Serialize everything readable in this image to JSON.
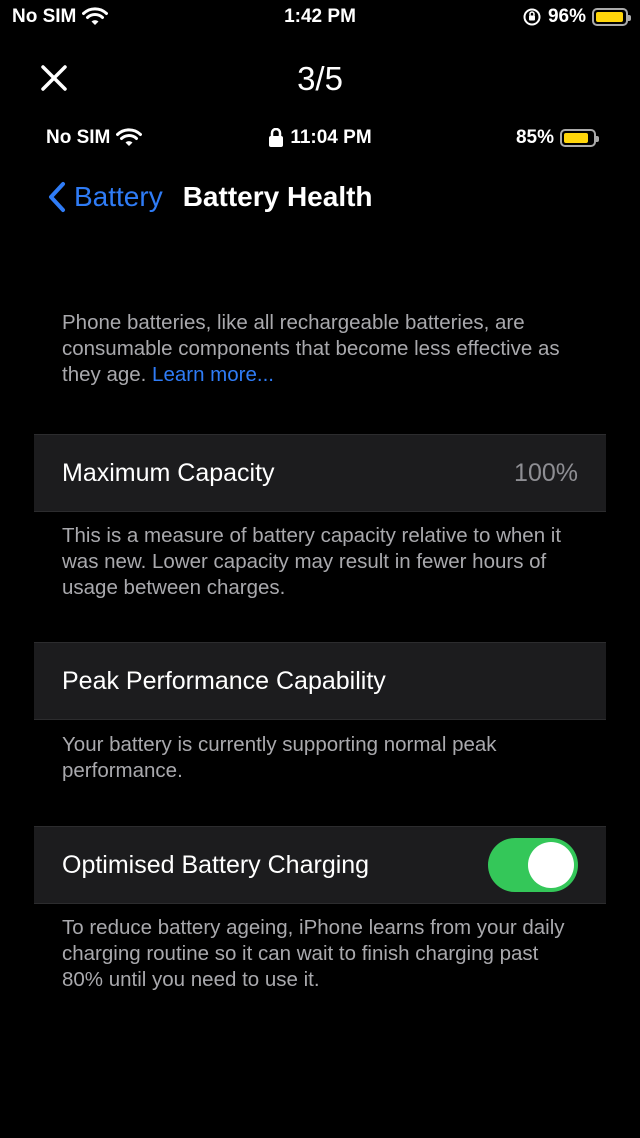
{
  "outer_status": {
    "carrier": "No SIM",
    "time": "1:42 PM",
    "battery": "96%",
    "battery_level": 0.96,
    "battery_color": "#ffd60a"
  },
  "viewer": {
    "counter": "3/5",
    "close_icon": "close-icon"
  },
  "inner_status": {
    "carrier": "No SIM",
    "time": "11:04 PM",
    "battery": "85%",
    "battery_level": 0.85
  },
  "nav": {
    "back_label": "Battery",
    "title": "Battery Health"
  },
  "intro": {
    "text": "Phone batteries, like all rechargeable batteries, are consumable components that become less effective as they age. ",
    "link": "Learn more..."
  },
  "max_capacity": {
    "label": "Maximum Capacity",
    "value": "100%",
    "desc": "This is a measure of battery capacity relative to when it was new. Lower capacity may result in fewer hours of usage between charges."
  },
  "peak": {
    "label": "Peak Performance Capability",
    "desc": "Your battery is currently supporting normal peak performance."
  },
  "optimised": {
    "label": "Optimised Battery Charging",
    "enabled": true,
    "toggle_color": "#34c759",
    "desc": "To reduce battery ageing, iPhone learns from your daily charging routine so it can wait to finish charging past 80% until you need to use it."
  },
  "accent": "#2f7cf6"
}
